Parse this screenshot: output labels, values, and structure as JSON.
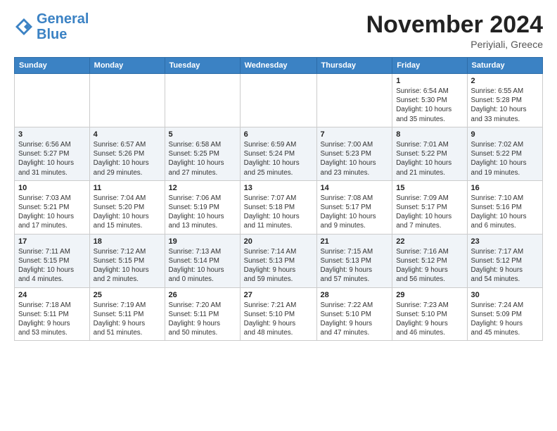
{
  "header": {
    "logo_line1": "General",
    "logo_line2": "Blue",
    "month": "November 2024",
    "location": "Periyiali, Greece"
  },
  "weekdays": [
    "Sunday",
    "Monday",
    "Tuesday",
    "Wednesday",
    "Thursday",
    "Friday",
    "Saturday"
  ],
  "weeks": [
    [
      {
        "day": "",
        "info": ""
      },
      {
        "day": "",
        "info": ""
      },
      {
        "day": "",
        "info": ""
      },
      {
        "day": "",
        "info": ""
      },
      {
        "day": "",
        "info": ""
      },
      {
        "day": "1",
        "info": "Sunrise: 6:54 AM\nSunset: 5:30 PM\nDaylight: 10 hours\nand 35 minutes."
      },
      {
        "day": "2",
        "info": "Sunrise: 6:55 AM\nSunset: 5:28 PM\nDaylight: 10 hours\nand 33 minutes."
      }
    ],
    [
      {
        "day": "3",
        "info": "Sunrise: 6:56 AM\nSunset: 5:27 PM\nDaylight: 10 hours\nand 31 minutes."
      },
      {
        "day": "4",
        "info": "Sunrise: 6:57 AM\nSunset: 5:26 PM\nDaylight: 10 hours\nand 29 minutes."
      },
      {
        "day": "5",
        "info": "Sunrise: 6:58 AM\nSunset: 5:25 PM\nDaylight: 10 hours\nand 27 minutes."
      },
      {
        "day": "6",
        "info": "Sunrise: 6:59 AM\nSunset: 5:24 PM\nDaylight: 10 hours\nand 25 minutes."
      },
      {
        "day": "7",
        "info": "Sunrise: 7:00 AM\nSunset: 5:23 PM\nDaylight: 10 hours\nand 23 minutes."
      },
      {
        "day": "8",
        "info": "Sunrise: 7:01 AM\nSunset: 5:22 PM\nDaylight: 10 hours\nand 21 minutes."
      },
      {
        "day": "9",
        "info": "Sunrise: 7:02 AM\nSunset: 5:22 PM\nDaylight: 10 hours\nand 19 minutes."
      }
    ],
    [
      {
        "day": "10",
        "info": "Sunrise: 7:03 AM\nSunset: 5:21 PM\nDaylight: 10 hours\nand 17 minutes."
      },
      {
        "day": "11",
        "info": "Sunrise: 7:04 AM\nSunset: 5:20 PM\nDaylight: 10 hours\nand 15 minutes."
      },
      {
        "day": "12",
        "info": "Sunrise: 7:06 AM\nSunset: 5:19 PM\nDaylight: 10 hours\nand 13 minutes."
      },
      {
        "day": "13",
        "info": "Sunrise: 7:07 AM\nSunset: 5:18 PM\nDaylight: 10 hours\nand 11 minutes."
      },
      {
        "day": "14",
        "info": "Sunrise: 7:08 AM\nSunset: 5:17 PM\nDaylight: 10 hours\nand 9 minutes."
      },
      {
        "day": "15",
        "info": "Sunrise: 7:09 AM\nSunset: 5:17 PM\nDaylight: 10 hours\nand 7 minutes."
      },
      {
        "day": "16",
        "info": "Sunrise: 7:10 AM\nSunset: 5:16 PM\nDaylight: 10 hours\nand 6 minutes."
      }
    ],
    [
      {
        "day": "17",
        "info": "Sunrise: 7:11 AM\nSunset: 5:15 PM\nDaylight: 10 hours\nand 4 minutes."
      },
      {
        "day": "18",
        "info": "Sunrise: 7:12 AM\nSunset: 5:15 PM\nDaylight: 10 hours\nand 2 minutes."
      },
      {
        "day": "19",
        "info": "Sunrise: 7:13 AM\nSunset: 5:14 PM\nDaylight: 10 hours\nand 0 minutes."
      },
      {
        "day": "20",
        "info": "Sunrise: 7:14 AM\nSunset: 5:13 PM\nDaylight: 9 hours\nand 59 minutes."
      },
      {
        "day": "21",
        "info": "Sunrise: 7:15 AM\nSunset: 5:13 PM\nDaylight: 9 hours\nand 57 minutes."
      },
      {
        "day": "22",
        "info": "Sunrise: 7:16 AM\nSunset: 5:12 PM\nDaylight: 9 hours\nand 56 minutes."
      },
      {
        "day": "23",
        "info": "Sunrise: 7:17 AM\nSunset: 5:12 PM\nDaylight: 9 hours\nand 54 minutes."
      }
    ],
    [
      {
        "day": "24",
        "info": "Sunrise: 7:18 AM\nSunset: 5:11 PM\nDaylight: 9 hours\nand 53 minutes."
      },
      {
        "day": "25",
        "info": "Sunrise: 7:19 AM\nSunset: 5:11 PM\nDaylight: 9 hours\nand 51 minutes."
      },
      {
        "day": "26",
        "info": "Sunrise: 7:20 AM\nSunset: 5:11 PM\nDaylight: 9 hours\nand 50 minutes."
      },
      {
        "day": "27",
        "info": "Sunrise: 7:21 AM\nSunset: 5:10 PM\nDaylight: 9 hours\nand 48 minutes."
      },
      {
        "day": "28",
        "info": "Sunrise: 7:22 AM\nSunset: 5:10 PM\nDaylight: 9 hours\nand 47 minutes."
      },
      {
        "day": "29",
        "info": "Sunrise: 7:23 AM\nSunset: 5:10 PM\nDaylight: 9 hours\nand 46 minutes."
      },
      {
        "day": "30",
        "info": "Sunrise: 7:24 AM\nSunset: 5:09 PM\nDaylight: 9 hours\nand 45 minutes."
      }
    ]
  ]
}
